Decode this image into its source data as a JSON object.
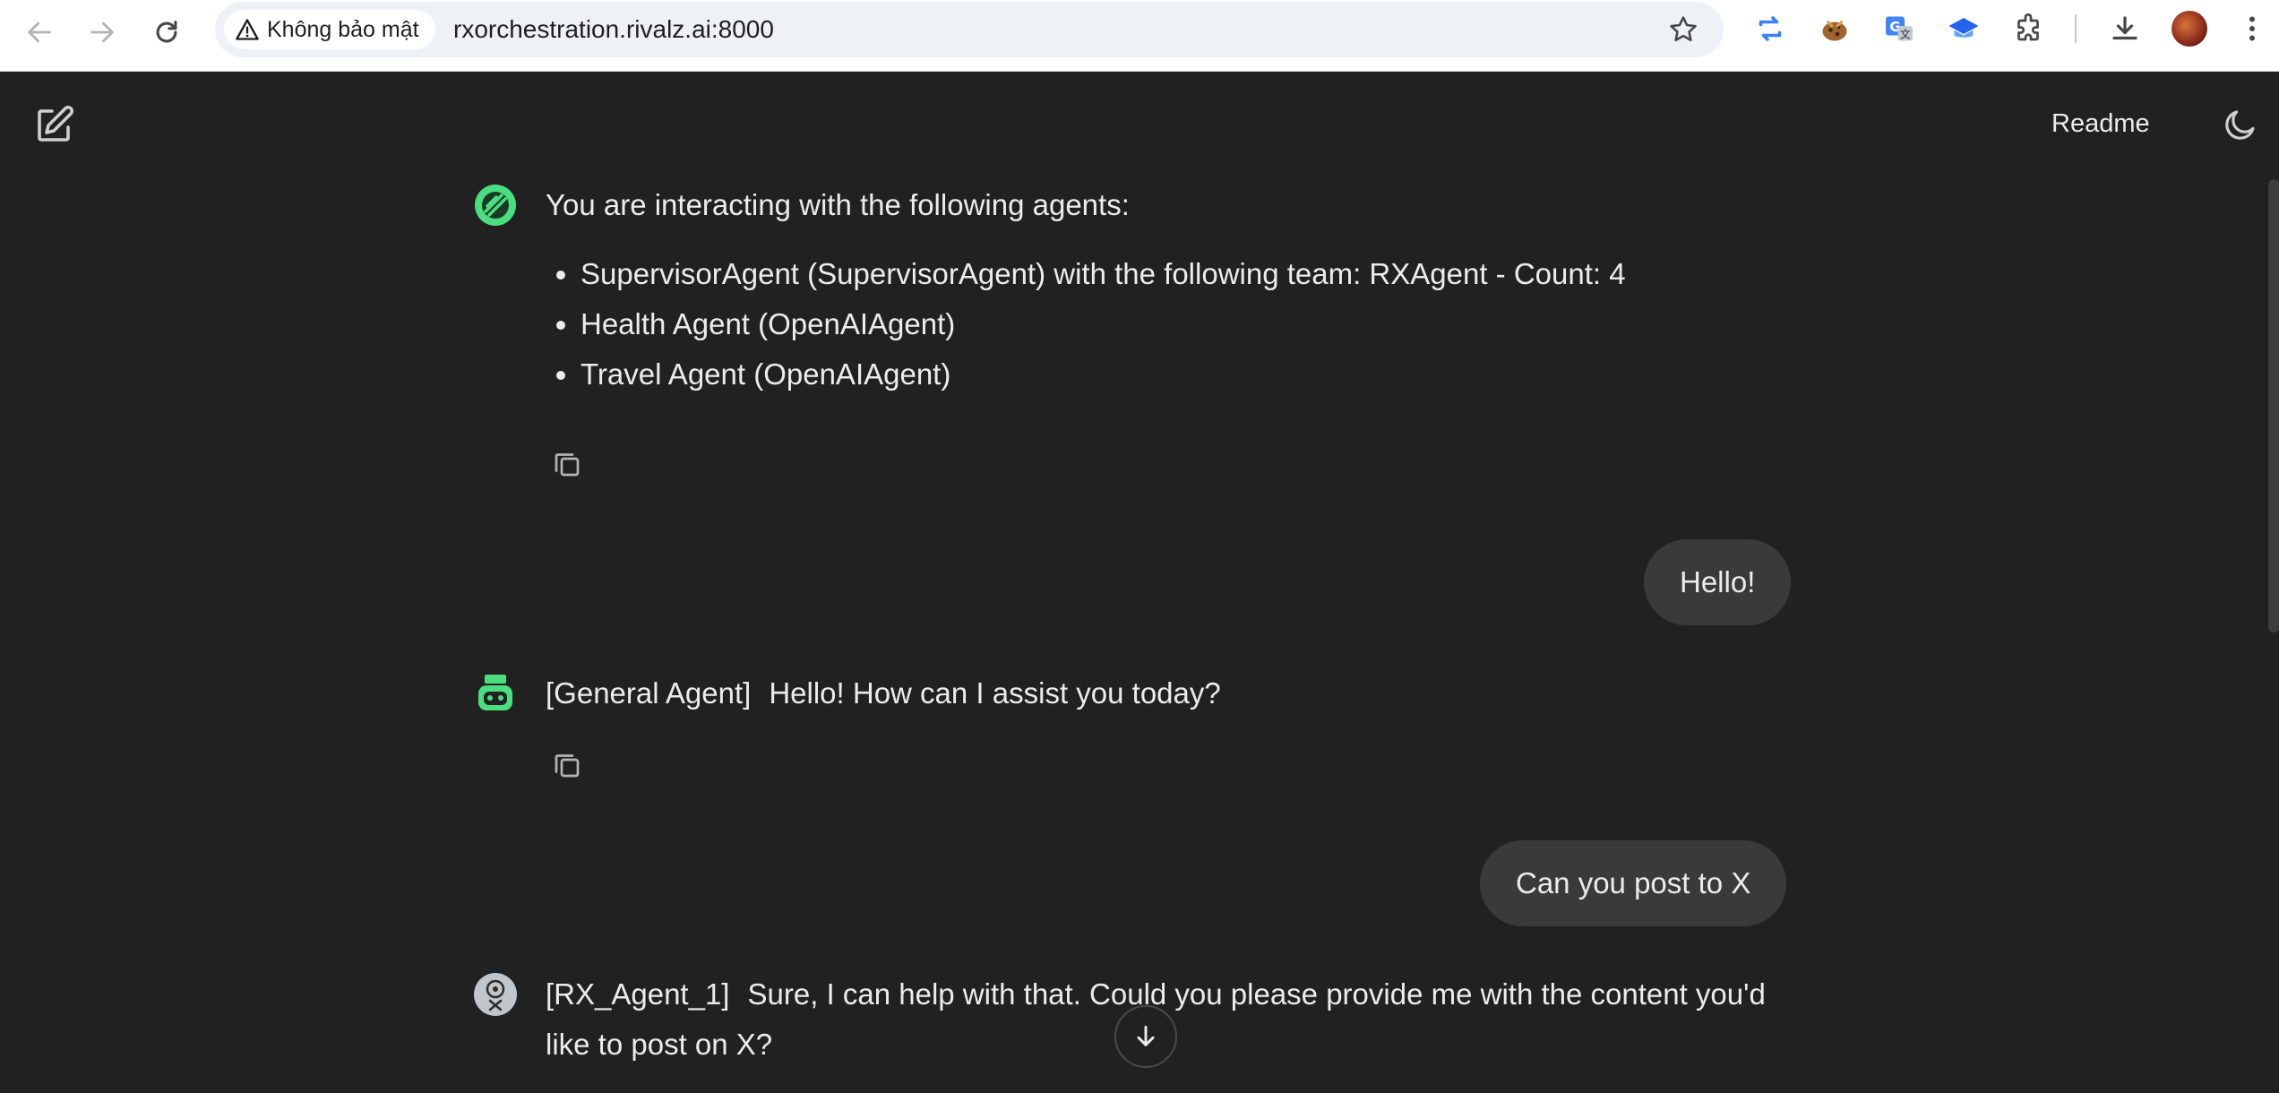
{
  "browser": {
    "security_label": "Không bảo mật",
    "url": "rxorchestration.rivalz.ai:8000"
  },
  "header": {
    "readme_label": "Readme"
  },
  "intro": {
    "heading": "You are interacting with the following agents:",
    "agents": [
      "SupervisorAgent (SupervisorAgent) with the following team: RXAgent - Count: 4",
      "Health Agent (OpenAIAgent)",
      "Travel Agent (OpenAIAgent)"
    ]
  },
  "messages": [
    {
      "role": "user",
      "text": "Hello!"
    },
    {
      "role": "agent",
      "tag": "[General Agent]",
      "text": "Hello! How can I assist you today?"
    },
    {
      "role": "user",
      "text": "Can you post to X"
    },
    {
      "role": "agent",
      "tag": "[RX_Agent_1]",
      "text": "Sure, I can help with that. Could you please provide me with the content you'd like to post on X?"
    }
  ],
  "icons": {
    "back": "arrow-left-icon",
    "forward": "arrow-right-icon",
    "reload": "reload-icon",
    "warning": "warning-triangle-icon",
    "bookmark": "star-icon",
    "new_chat": "edit-icon",
    "theme": "moon-icon",
    "copy": "copy-icon",
    "scroll": "arrow-down-icon"
  },
  "colors": {
    "background": "#212121",
    "user_bubble": "#3a3a3a",
    "text": "#ececec",
    "agent_green": "#4ade80"
  }
}
